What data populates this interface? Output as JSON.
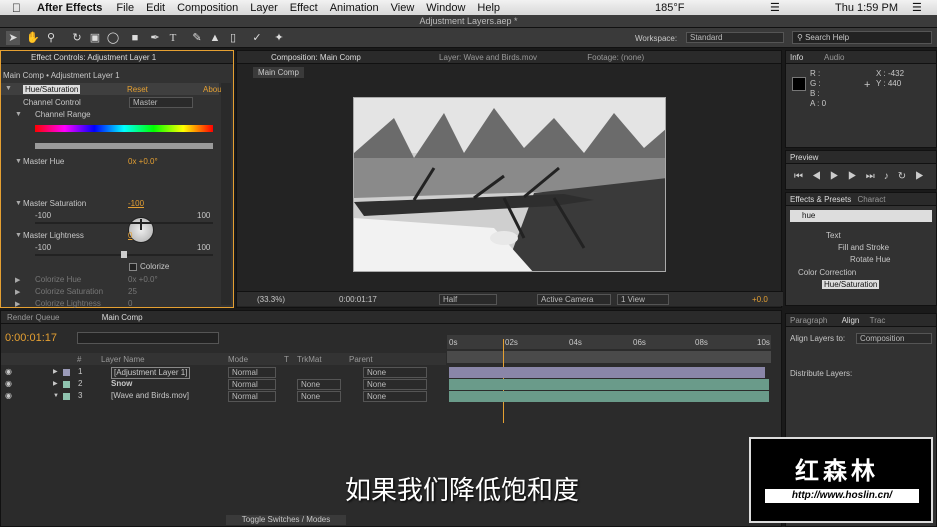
{
  "menu": {
    "apple": "",
    "app": "After Effects",
    "items": [
      "File",
      "Edit",
      "Composition",
      "Layer",
      "Effect",
      "Animation",
      "View",
      "Window",
      "Help"
    ],
    "temp": "185°F",
    "clock": "Thu 1:59 PM"
  },
  "title": "Adjustment Layers.aep *",
  "toolbar": {
    "workspace_label": "Workspace:",
    "workspace_value": "Standard",
    "search_placeholder": "Search Help"
  },
  "effects": {
    "tab": "Effect Controls: Adjustment Layer 1",
    "breadcrumb": "Main Comp • Adjustment Layer 1",
    "effect_name": "Hue/Saturation",
    "reset": "Reset",
    "about": "Abou",
    "channel_control_label": "Channel Control",
    "channel_control_value": "Master",
    "channel_range": "Channel Range",
    "master_hue": "Master Hue",
    "master_hue_value": "0x +0.0°",
    "master_saturation": "Master Saturation",
    "master_saturation_value": "-100",
    "sat_min": "-100",
    "sat_max": "100",
    "master_lightness": "Master Lightness",
    "master_lightness_value": "0",
    "light_min": "-100",
    "light_max": "100",
    "colorize": "Colorize",
    "colorize_hue": "Colorize Hue",
    "colorize_hue_value": "0x +0.0°",
    "colorize_saturation": "Colorize Saturation",
    "colorize_saturation_value": "25",
    "colorize_lightness": "Colorize Lightness",
    "colorize_lightness_value": "0"
  },
  "comp": {
    "tab": "Composition: Main Comp",
    "layer_tab": "Layer: Wave and Birds.mov",
    "footage_tab": "Footage: (none)",
    "subtab": "Main Comp",
    "zoom": "(33.3%)",
    "timecode": "0:00:01:17",
    "resolution": "Half",
    "camera": "Active Camera",
    "view": "1 View",
    "exposure": "+0.0"
  },
  "info": {
    "tab_info": "Info",
    "tab_audio": "Audio",
    "r": "R :",
    "g": "G :",
    "b": "B :",
    "a": "A : 0",
    "x": "X : -432",
    "y": "Y : 440"
  },
  "preview": {
    "tab": "Preview"
  },
  "effects_presets": {
    "tab": "Effects & Presets",
    "tab2": "Charact",
    "search": "hue",
    "tree": [
      "Text",
      "Fill and Stroke",
      "Rotate Hue",
      "Color Correction",
      "Hue/Saturation"
    ]
  },
  "align": {
    "tab_paragraph": "Paragraph",
    "tab_align": "Align",
    "tab_tracker": "Trac",
    "align_to_label": "Align Layers to:",
    "align_to_value": "Composition",
    "distribute": "Distribute Layers:"
  },
  "timeline": {
    "tab_render": "Render Queue",
    "tab_comp": "Main Comp",
    "timecode": "0:00:01:17",
    "cols": {
      "num": "#",
      "name": "Layer Name",
      "mode": "Mode",
      "t": "T",
      "trkmat": "TrkMat",
      "parent": "Parent"
    },
    "rows": [
      {
        "num": "1",
        "name": "[Adjustment Layer 1]",
        "mode": "Normal",
        "trkmat": "",
        "parent": "None"
      },
      {
        "num": "2",
        "name": "Snow",
        "mode": "Normal",
        "trkmat": "None",
        "parent": "None"
      },
      {
        "num": "3",
        "name": "[Wave and Birds.mov]",
        "mode": "Normal",
        "trkmat": "None",
        "parent": "None"
      }
    ],
    "ruler": [
      "0s",
      "02s",
      "04s",
      "06s",
      "08s",
      "10s"
    ],
    "toggle": "Toggle Switches / Modes"
  },
  "subtitle": "如果我们降低饱和度",
  "watermark": {
    "title": "红森林",
    "url": "http://www.hoslin.cn/"
  },
  "colors": {
    "accent": "#e5a032",
    "track_green": "#6a9b8a",
    "track_purple": "#8a86a8"
  }
}
